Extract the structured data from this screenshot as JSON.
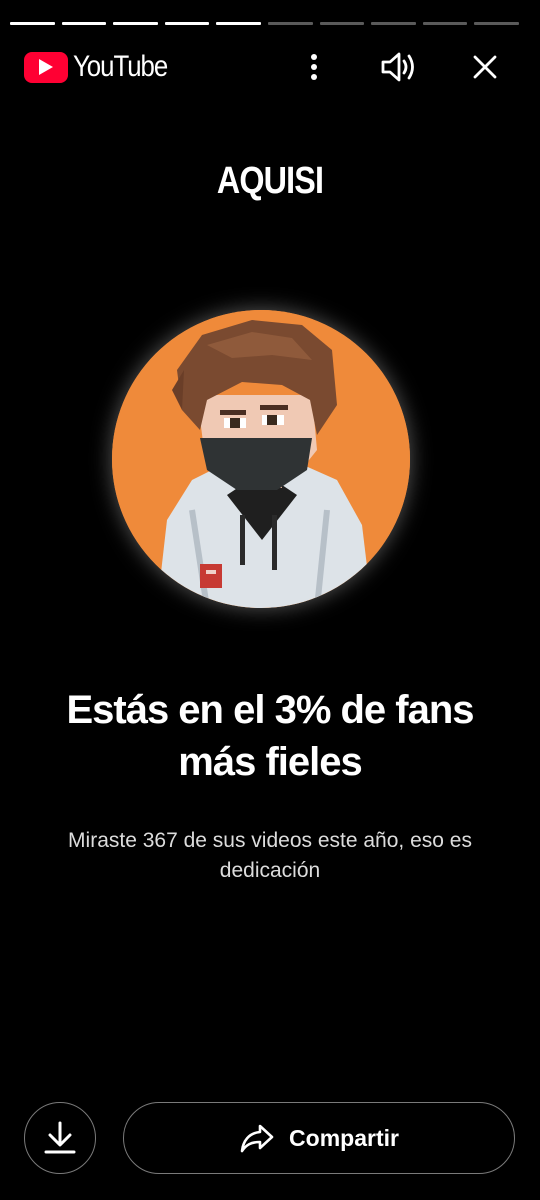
{
  "brand": {
    "name": "YouTube",
    "accent": "#ff0033"
  },
  "progress": {
    "total_segments": 10,
    "completed_segments": 5
  },
  "header_icons": [
    "more-vert-icon",
    "volume-icon",
    "close-icon"
  ],
  "story": {
    "channel_name": "AQUISI",
    "headline": "Estás en el 3% de fans más fieles",
    "subtext": "Miraste 367 de sus videos este año, eso es dedicación",
    "avatar_background": "#ef8a3a"
  },
  "actions": {
    "download_icon": "download-icon",
    "share_icon": "share-icon",
    "share_label": "Compartir"
  }
}
